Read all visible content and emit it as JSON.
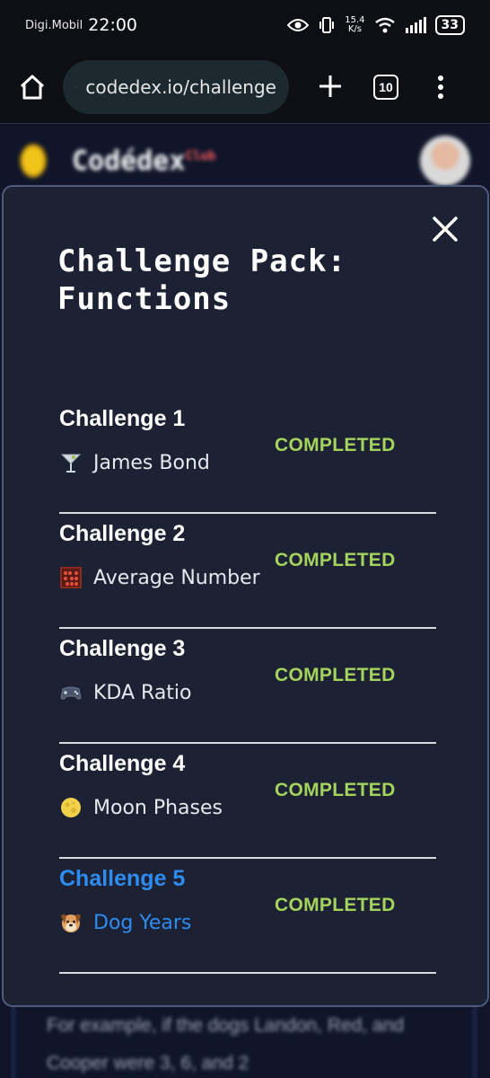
{
  "status_bar": {
    "carrier": "Digi.Mobil",
    "time": "22:00",
    "net_speed_value": "15.4",
    "net_speed_unit": "K/s",
    "battery": "33"
  },
  "browser": {
    "url": "codedex.io/challenge",
    "tab_count": "10"
  },
  "site": {
    "logo": "Codédex",
    "logo_badge": "Club",
    "background_text": "For example, if the dogs Landon, Red, and Cooper were 3, 6, and 2"
  },
  "modal": {
    "title": "Challenge Pack: Functions",
    "challenges": [
      {
        "heading": "Challenge 1",
        "name": "James Bond",
        "emoji": "cocktail-glass-icon",
        "status": "COMPLETED",
        "active": false
      },
      {
        "heading": "Challenge 2",
        "name": "Average Number",
        "emoji": "abacus-icon",
        "status": "COMPLETED",
        "active": false
      },
      {
        "heading": "Challenge 3",
        "name": "KDA Ratio",
        "emoji": "game-controller-icon",
        "status": "COMPLETED",
        "active": false
      },
      {
        "heading": "Challenge 4",
        "name": "Moon Phases",
        "emoji": "full-moon-icon",
        "status": "COMPLETED",
        "active": false
      },
      {
        "heading": "Challenge 5",
        "name": "Dog Years",
        "emoji": "dog-face-icon",
        "status": "COMPLETED",
        "active": true
      }
    ]
  },
  "colors": {
    "modal_bg": "#1c2233",
    "completed": "#a5d45d",
    "active_link": "#2e8cf0"
  }
}
